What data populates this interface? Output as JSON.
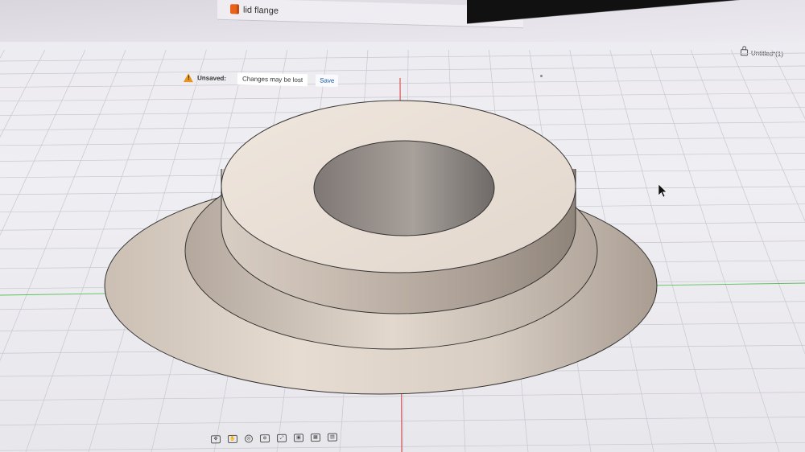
{
  "document_tab": {
    "title": "lid flange",
    "close_glyph": "×",
    "icon": "design-file-icon",
    "icon_color": "#e8621a"
  },
  "file_status": {
    "label": "Untitled*(1)",
    "icon": "lock-icon"
  },
  "notification": {
    "icon": "warning-icon",
    "icon_color": "#e8961a",
    "label": "Unsaved:",
    "message": "Changes may be lost",
    "save_label": "Save",
    "save_color": "#1a5aa8"
  },
  "viewport": {
    "background": "#efeef2",
    "grid_color": "#c9c7cf",
    "axis_red": "#d94a4a",
    "axis_green": "#5cc05c",
    "model_color": "#e7ddd3",
    "model_shadow": "#a89c91",
    "bore_color": "#8f8985"
  },
  "navigation_toolbar": {
    "tools": [
      {
        "name": "orbit-icon",
        "glyph": "✥"
      },
      {
        "name": "pan-icon",
        "glyph": "✋"
      },
      {
        "name": "look-at-icon",
        "glyph": "◎"
      },
      {
        "name": "zoom-window-icon",
        "glyph": "⊕"
      },
      {
        "name": "fit-icon",
        "glyph": "⤢"
      },
      {
        "name": "display-settings-icon",
        "glyph": "▣"
      },
      {
        "name": "grid-settings-icon",
        "glyph": "▦"
      },
      {
        "name": "viewports-icon",
        "glyph": "▤"
      }
    ]
  }
}
